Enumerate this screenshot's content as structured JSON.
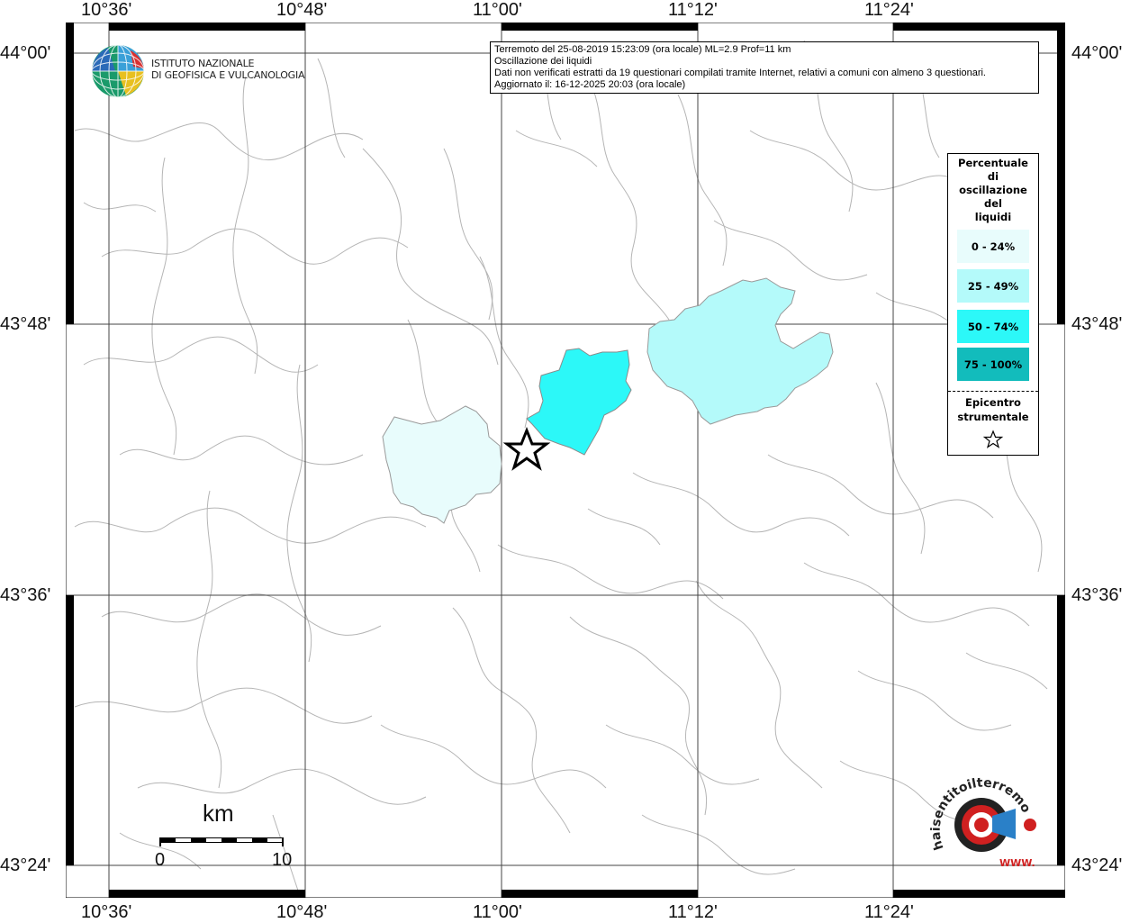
{
  "map": {
    "lon_labels": [
      "10°36'",
      "10°48'",
      "11°00'",
      "11°12'",
      "11°24'"
    ],
    "lat_labels": [
      "44°00'",
      "43°48'",
      "43°36'",
      "43°24'"
    ]
  },
  "info": {
    "line1": "Terremoto del 25-08-2019 15:23:09 (ora locale) ML=2.9 Prof=11 km",
    "line2": "Oscillazione dei liquidi",
    "line3": "Dati non verificati estratti da 19 questionari compilati tramite Internet, relativi a comuni con almeno 3 questionari.",
    "line4": "Aggiornato il: 16-12-2025 20:03 (ora locale)"
  },
  "logo": {
    "line1": "ISTITUTO NAZIONALE",
    "line2": "DI GEOFISICA E VULCANOLOGIA"
  },
  "legend": {
    "title": [
      "Percentuale",
      "di",
      "oscillazione",
      "del",
      "liquidi"
    ],
    "items": [
      {
        "label": "0 - 24%",
        "color": "#e8fcfc"
      },
      {
        "label": "25 - 49%",
        "color": "#b4fafa"
      },
      {
        "label": "50 - 74%",
        "color": "#2cf8f8"
      },
      {
        "label": "75 - 100%",
        "color": "#12bcbc"
      }
    ],
    "epicenter": [
      "Epicentro",
      "strumentale"
    ]
  },
  "scale": {
    "title": "km",
    "label_start": "0",
    "label_end": "10"
  },
  "watermark": {
    "text": "haisentitoilterremoto.it",
    "url": "WWW."
  }
}
